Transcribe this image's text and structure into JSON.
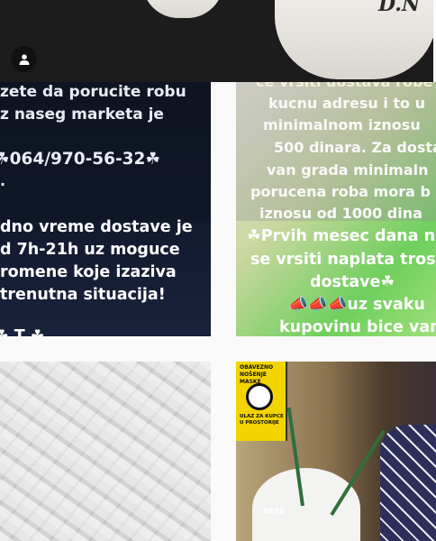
{
  "top_post": {
    "cup_text": "D.N"
  },
  "left_tile": {
    "lines": [
      "zete da porucite robu",
      "z naseg marketa je",
      "☘064/970-56-32☘",
      ".",
      "dno vreme dostave je",
      "d 7h-21h uz moguce",
      "romene koje izaziva",
      "trenutna situacija!",
      "☘ T   ☘"
    ]
  },
  "right_tile": {
    "lines": [
      "ce vrsiti dostava robe",
      "kucnu adresu i to u",
      "minimalnom iznosu",
      "500 dinara. Za dosta",
      "van grada minimaln",
      "porucena roba mora b",
      "iznosu od 1000 dina",
      "☘Prvih mesec dana n",
      "se vrsiti naplata trosk",
      "dostave☘",
      "📣📣📣uz svaku",
      "kupovinu bice vam"
    ]
  },
  "bottom_right": {
    "sign_top": "OBAVEZNO NOŠENJE MASKE",
    "sign_bottom": "ULAZ ZA KUPCE U PROSTORIJE",
    "cake_text": "TATA"
  }
}
